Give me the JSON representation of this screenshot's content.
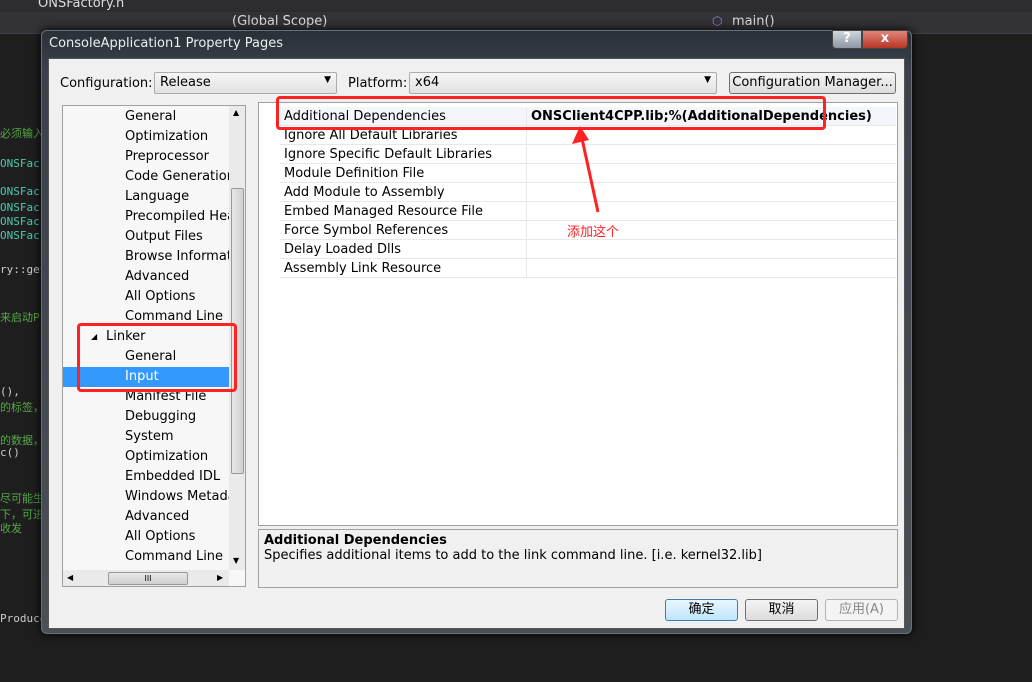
{
  "editor": {
    "tab": "ONSFactory.h",
    "scope": "(Global Scope)",
    "function": "main()",
    "code_fragments": [
      "必须输入",
      "ONSFac",
      "ONSFac",
      "ONSFac",
      "ONSFac",
      "ONSFac",
      "ry::get",
      "来启动P",
      "(),",
      "的标签，",
      "的数据，",
      "c()",
      "尽可能生",
      "下，可进",
      "收发",
      "Produce"
    ]
  },
  "dialog": {
    "title": "ConsoleApplication1 Property Pages",
    "help": "?",
    "close": "x",
    "configuration_label": "Configuration:",
    "configuration_value": "Release",
    "platform_label": "Platform:",
    "platform_value": "x64",
    "config_manager": "Configuration Manager...",
    "tree": [
      {
        "label": "General"
      },
      {
        "label": "Optimization"
      },
      {
        "label": "Preprocessor"
      },
      {
        "label": "Code Generation"
      },
      {
        "label": "Language"
      },
      {
        "label": "Precompiled Headers"
      },
      {
        "label": "Output Files"
      },
      {
        "label": "Browse Information"
      },
      {
        "label": "Advanced"
      },
      {
        "label": "All Options"
      },
      {
        "label": "Command Line"
      },
      {
        "label": "Linker",
        "expanded": true
      },
      {
        "label": "General"
      },
      {
        "label": "Input",
        "selected": true
      },
      {
        "label": "Manifest File"
      },
      {
        "label": "Debugging"
      },
      {
        "label": "System"
      },
      {
        "label": "Optimization"
      },
      {
        "label": "Embedded IDL"
      },
      {
        "label": "Windows Metadata"
      },
      {
        "label": "Advanced"
      },
      {
        "label": "All Options"
      },
      {
        "label": "Command Line"
      }
    ],
    "properties": [
      {
        "name": "Additional Dependencies",
        "value": "ONSClient4CPP.lib;%(AdditionalDependencies)"
      },
      {
        "name": "Ignore All Default Libraries",
        "value": ""
      },
      {
        "name": "Ignore Specific Default Libraries",
        "value": ""
      },
      {
        "name": "Module Definition File",
        "value": ""
      },
      {
        "name": "Add Module to Assembly",
        "value": ""
      },
      {
        "name": "Embed Managed Resource File",
        "value": ""
      },
      {
        "name": "Force Symbol References",
        "value": ""
      },
      {
        "name": "Delay Loaded Dlls",
        "value": ""
      },
      {
        "name": "Assembly Link Resource",
        "value": ""
      }
    ],
    "description_title": "Additional Dependencies",
    "description_text": "Specifies additional items to add to the link command line. [i.e. kernel32.lib]",
    "ok": "确定",
    "cancel": "取消",
    "apply": "应用(A)"
  },
  "annotation": {
    "text": "添加这个",
    "color": "#ff2222"
  }
}
